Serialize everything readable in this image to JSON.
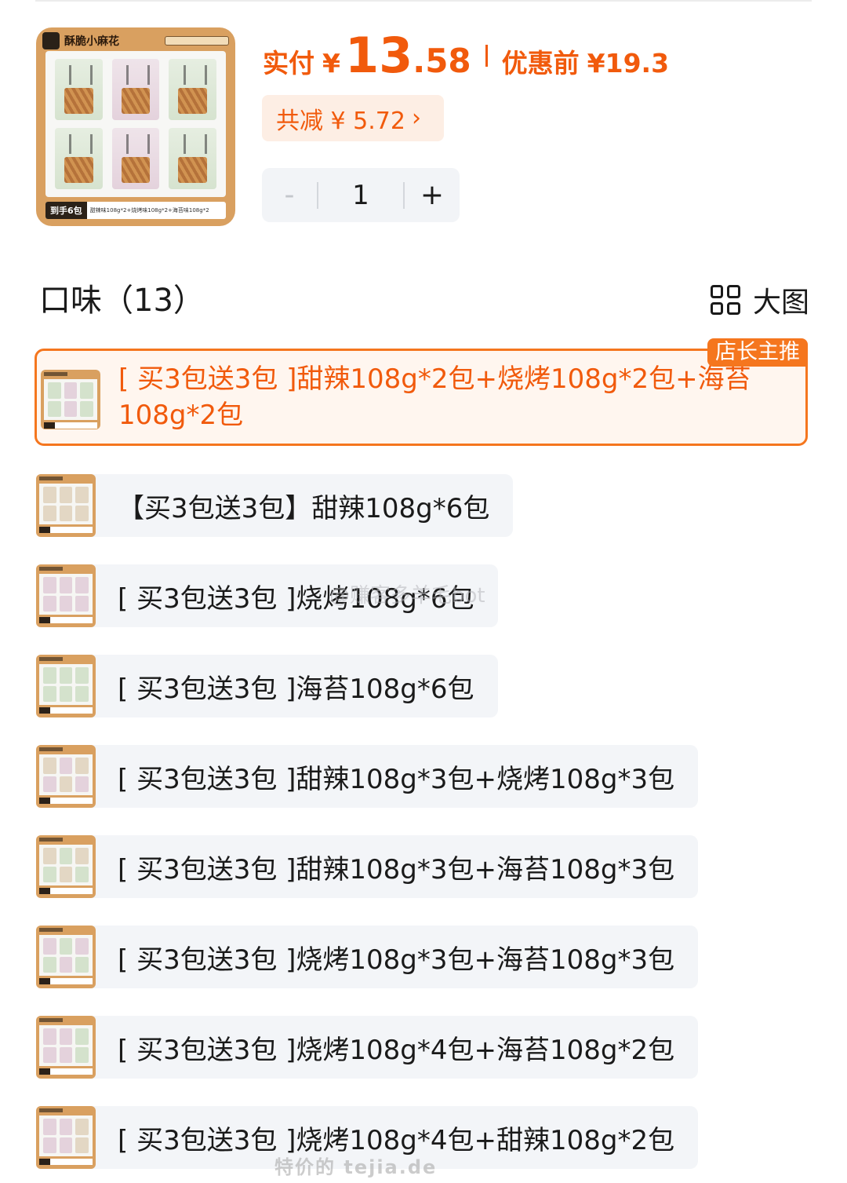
{
  "product": {
    "brand": "酥脆小麻花",
    "thumb_tag": "到手6包",
    "thumb_caption": "甜辣味108g*2+烧烤味108g*2+海苔味108g*2"
  },
  "price": {
    "label": "实付",
    "currency": "¥",
    "integer": "13",
    "decimal": ".58",
    "original_label": "优惠前",
    "original_value": "¥19.3",
    "discount_text": "共减 ¥ 5.72",
    "discount_chevron": "›"
  },
  "quantity": {
    "minus": "-",
    "value": "1",
    "plus": "+"
  },
  "flavors": {
    "title": "口味（13）",
    "view_toggle_label": "大图",
    "recommend_badge": "店长主推",
    "options": [
      "[ 买3包送3包 ]甜辣108g*2包+烧烤108g*2包+海苔108g*2包",
      "【买3包送3包】甜辣108g*6包",
      "[ 买3包送3包 ]烧烤108g*6包",
      "[ 买3包送3包 ]海苔108g*6包",
      "[ 买3包送3包 ]甜辣108g*3包+烧烤108g*3包",
      "[ 买3包送3包 ]甜辣108g*3包+海苔108g*3包",
      "[ 买3包送3包 ]烧烤108g*3包+海苔108g*3包",
      "[ 买3包送3包 ]烧烤108g*4包+海苔108g*2包",
      "[ 买3包送3包 ]烧烤108g*4包+甜辣108g*2包"
    ]
  },
  "watermarks": {
    "overlay": "@赚客多羊毛bot",
    "footer": "特价的 tejia.de"
  },
  "colors": {
    "accent": "#f15a0c",
    "accent_border": "#f5761e",
    "pill_bg": "#fdeee4",
    "option_bg": "#f3f5f8"
  }
}
